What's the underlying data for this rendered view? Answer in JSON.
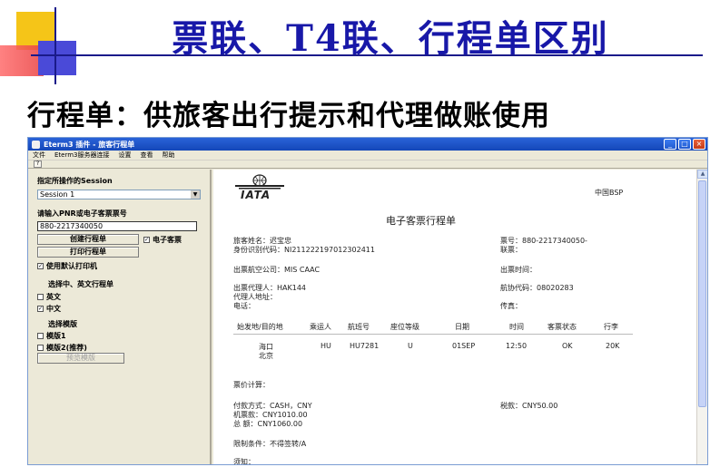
{
  "slide": {
    "title": "票联、T4联、行程单区别",
    "subtitle": "行程单：供旅客出行提示和代理做账使用"
  },
  "window": {
    "title": "Eterm3 插件 - 旅客行程单",
    "menu": [
      "文件",
      "Eterm3服务器连接",
      "设置",
      "查看",
      "帮助"
    ],
    "controls": [
      "_",
      "□",
      "×"
    ]
  },
  "left": {
    "session_label": "指定所操作的Session",
    "session_value": "Session 1",
    "pnr_label": "请输入PNR或电子客票票号",
    "pnr_value": "880-2217340050",
    "create_button": "创建行程单",
    "eticket_checkbox": "电子客票",
    "print_button": "打印行程单",
    "default_printer": "使用默认打印机",
    "lang_label": "选择中、英文行程单",
    "english": "英文",
    "chinese": "中文",
    "template_label": "选择模版",
    "template1": "模版1",
    "template2": "模版2(推荐)",
    "preview_button": "预览模版"
  },
  "doc": {
    "iata_text": "IATA",
    "bsp": "中国BSP",
    "heading": "电子客票行程单",
    "passenger_name": "旅客姓名：迟宝忠",
    "id_number": "身份识别代码：NI211222197012302411",
    "ticket_no": "票号：880-2217340050-",
    "coupon": "联票：",
    "issuing_airline": "出票航空公司：MIS CAAC",
    "issue_time": "出票时间：",
    "agent": "出票代理人：HAK144",
    "iata_code": "航协代码：08020283",
    "agent_address": "代理人地址：",
    "phone": "电话：",
    "fax": "传真：",
    "table_headers": [
      "始发地/目的地",
      "乘运人",
      "航班号",
      "座位等级",
      "日期",
      "时间",
      "客票状态",
      "行李"
    ],
    "segment": {
      "from": "海口",
      "to": "北京",
      "carrier": "HU",
      "flight": "HU7281",
      "class": "U",
      "date": "01SEP",
      "time": "12:50",
      "status": "OK",
      "baggage": "20K"
    },
    "fare_calc": "票价计算：",
    "payment": "付款方式：CASH，CNY",
    "tax": "税款：CNY50.00",
    "air_fare": "机票款：CNY1010.00",
    "total": "总  额：CNY1060.00",
    "restrictions": "限制条件：不得签转/A",
    "notice": "须知："
  }
}
